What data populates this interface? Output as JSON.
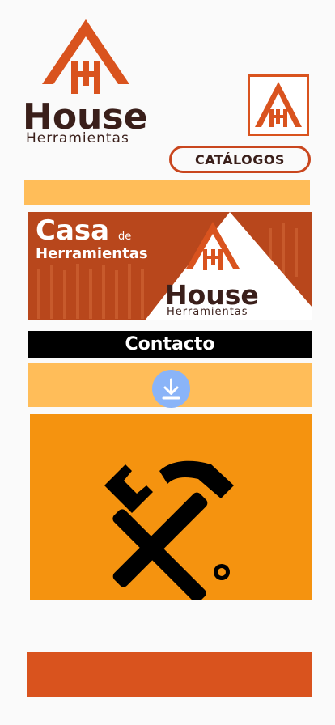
{
  "logo": {
    "title": "House",
    "subtitle": "Herramientas",
    "accent_color": "#d9531e",
    "text_color": "#3a1f1a"
  },
  "small_logo": {
    "icon": "house-logo-icon"
  },
  "catalog_button": {
    "label": "CATÁLOGOS"
  },
  "banner": {
    "line1": "Casa",
    "line1_small": "de",
    "line2": "Herramientas",
    "brand": "House",
    "brand_sub": "Herramientas"
  },
  "contact": {
    "label": "Contacto"
  },
  "download": {
    "icon": "download-icon",
    "color": "#8ab4f8"
  },
  "tools_panel": {
    "icon": "wrench-hammer-icon",
    "color": "#f5930f"
  },
  "colors": {
    "strip": "#ffbd59",
    "bottom_bar": "#d9531e",
    "contact_bg": "#000000"
  }
}
